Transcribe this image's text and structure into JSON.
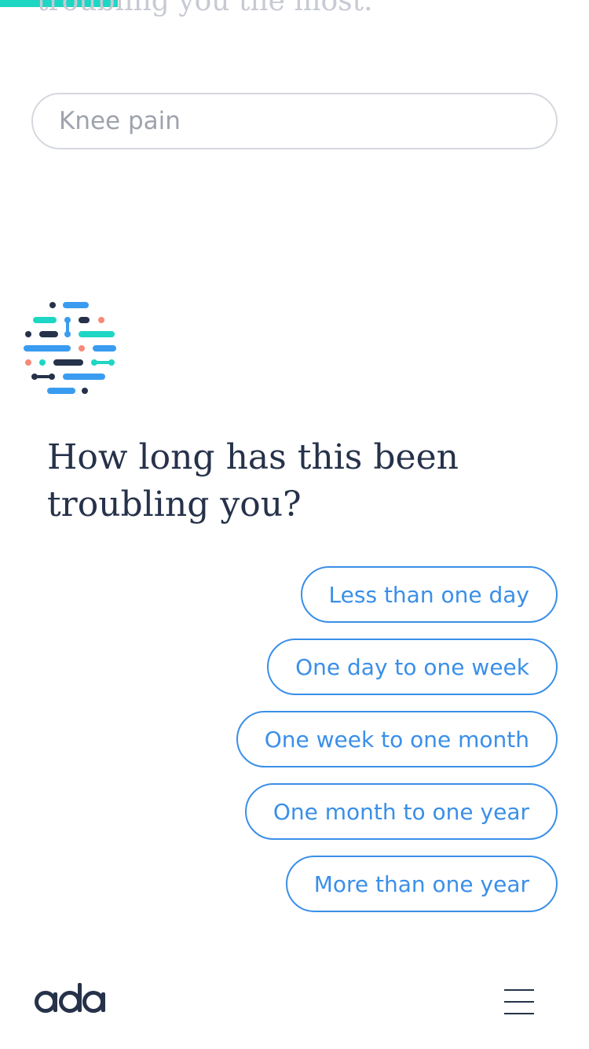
{
  "progress": {
    "fraction": 0.2,
    "color": "#1ed6c4"
  },
  "previous": {
    "question_tail": "troubling you the most.",
    "answer": "Knee pain"
  },
  "chat": {
    "question": "How long has this been troubling you?"
  },
  "options": [
    {
      "label": "Less than one day"
    },
    {
      "label": "One day to one week"
    },
    {
      "label": "One week to one month"
    },
    {
      "label": "One month to one year"
    },
    {
      "label": "More than one year"
    }
  ],
  "footer": {
    "logo_text": "ada",
    "menu_icon": "hamburger-menu-icon"
  },
  "colors": {
    "accent": "#3a8fe8",
    "teal": "#1ed6c4",
    "navy": "#26324a",
    "coral": "#f68a7a"
  }
}
